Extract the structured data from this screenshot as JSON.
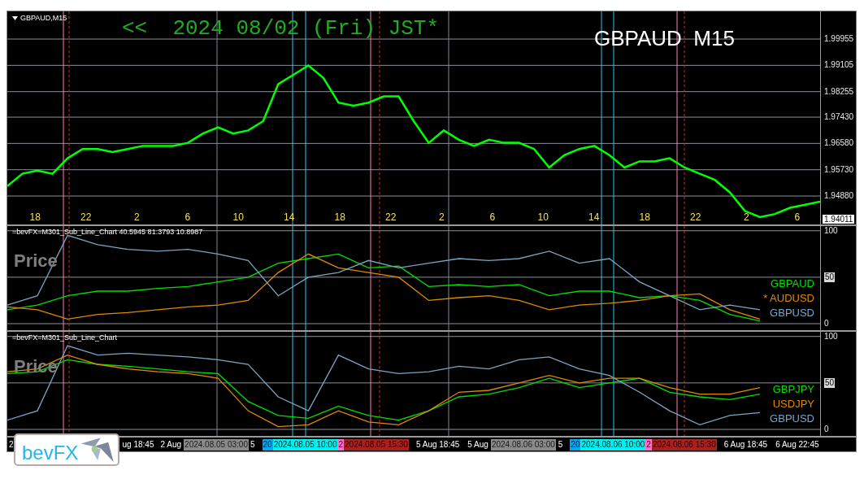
{
  "main_pane": {
    "title": "GBPAUD,M15",
    "date_banner": "<<  2024 08/02 (Fri) JST*",
    "symbol_banner": "GBPAUD  M15",
    "current_price": "1.94011",
    "hour_labels": [
      "18",
      "22",
      "2",
      "6",
      "10",
      "14",
      "18",
      "22",
      "2",
      "6",
      "10",
      "14",
      "18",
      "22",
      "2",
      "6"
    ],
    "chart_data": {
      "type": "line",
      "grid": true,
      "ylim": [
        1.9396,
        2.0085
      ],
      "yticks": [
        {
          "value": 1.99955,
          "label": "1.99955"
        },
        {
          "value": 1.99105,
          "label": "1.99105"
        },
        {
          "value": 1.98255,
          "label": "1.98255"
        },
        {
          "value": 1.9743,
          "label": "1.97430"
        },
        {
          "value": 1.9658,
          "label": "1.96580"
        },
        {
          "value": 1.9573,
          "label": "1.95730"
        },
        {
          "value": 1.9488,
          "label": "1.94880"
        }
      ],
      "values": [
        1.952,
        1.956,
        1.957,
        1.956,
        1.961,
        1.964,
        1.964,
        1.963,
        1.964,
        1.965,
        1.965,
        1.965,
        1.966,
        1.969,
        1.971,
        1.969,
        1.97,
        1.973,
        1.985,
        1.988,
        1.991,
        1.987,
        1.979,
        1.978,
        1.979,
        1.981,
        1.981,
        1.973,
        1.966,
        1.97,
        1.967,
        1.965,
        1.967,
        1.966,
        1.966,
        1.964,
        1.958,
        1.962,
        1.964,
        1.965,
        1.962,
        1.958,
        1.96,
        1.96,
        1.961,
        1.958,
        1.956,
        1.954,
        1.95,
        1.944,
        1.942,
        1.943,
        1.945,
        1.946,
        1.947
      ]
    }
  },
  "sub_panes": [
    {
      "title": "=bevFX=M301_Sub_Line_Chart 40.5945 81.3793 10.8987",
      "watermark": "Price",
      "chart_data": {
        "type": "line",
        "grid": true,
        "ylim": [
          -7,
          105
        ],
        "yticks": [
          0,
          50,
          100
        ],
        "series": [
          {
            "name": "GBPAUD",
            "color": "#00e000",
            "values": [
              15,
              20,
              30,
              35,
              35,
              38,
              40,
              45,
              50,
              65,
              70,
              75,
              60,
              62,
              40,
              42,
              40,
              42,
              30,
              35,
              35,
              28,
              30,
              25,
              10,
              3,
              null,
              null
            ]
          },
          {
            "name": "* AUDUSD",
            "color": "#e08a00",
            "values": [
              18,
              15,
              5,
              10,
              12,
              15,
              18,
              20,
              25,
              55,
              75,
              60,
              55,
              50,
              25,
              28,
              30,
              25,
              15,
              20,
              22,
              25,
              30,
              32,
              15,
              5,
              null,
              null
            ]
          },
          {
            "name": "GBPUSD",
            "color": "#7aa6c2",
            "values": [
              20,
              30,
              95,
              85,
              80,
              78,
              80,
              75,
              68,
              30,
              50,
              55,
              68,
              60,
              65,
              70,
              68,
              70,
              78,
              65,
              70,
              45,
              30,
              15,
              20,
              15,
              null,
              null
            ]
          }
        ]
      }
    },
    {
      "title": "=bevFX=M301_Sub_Line_Chart",
      "watermark": "Price",
      "chart_data": {
        "type": "line",
        "grid": true,
        "ylim": [
          -7,
          105
        ],
        "yticks": [
          0,
          50,
          100
        ],
        "series": [
          {
            "name": "GBPJPY",
            "color": "#00e000",
            "values": [
              60,
              62,
              75,
              70,
              68,
              65,
              62,
              60,
              30,
              15,
              12,
              25,
              15,
              10,
              20,
              35,
              38,
              45,
              55,
              45,
              50,
              55,
              40,
              35,
              32,
              38,
              null,
              null
            ]
          },
          {
            "name": "USDJPY",
            "color": "#e08a00",
            "values": [
              62,
              65,
              80,
              70,
              65,
              62,
              60,
              55,
              20,
              3,
              5,
              20,
              8,
              5,
              20,
              40,
              42,
              50,
              58,
              50,
              55,
              55,
              45,
              38,
              38,
              45,
              null,
              null
            ]
          },
          {
            "name": "GBPUSD",
            "color": "#7aa6c2",
            "values": [
              10,
              20,
              90,
              80,
              82,
              80,
              78,
              75,
              70,
              35,
              20,
              80,
              65,
              60,
              62,
              68,
              65,
              75,
              78,
              65,
              58,
              40,
              20,
              5,
              15,
              18,
              null,
              null
            ]
          }
        ]
      }
    }
  ],
  "time_axis": [
    {
      "text": "2",
      "kind": "plain"
    },
    {
      "text": "ug 18:45",
      "kind": "plain"
    },
    {
      "text": "2 Aug",
      "kind": "plain"
    },
    {
      "text": "2024.08.05 03:00",
      "kind": "grey"
    },
    {
      "text": "5",
      "kind": "plain"
    },
    {
      "text": "20",
      "kind": "blue"
    },
    {
      "text": "2024.08.05 10:00",
      "kind": "cyan"
    },
    {
      "text": "2",
      "kind": "pink"
    },
    {
      "text": "2024.08.05 15:30",
      "kind": "red"
    },
    {
      "text": "5 Aug 18:45",
      "kind": "plain"
    },
    {
      "text": "5 Aug",
      "kind": "plain"
    },
    {
      "text": "2024.08.06 03:00",
      "kind": "grey"
    },
    {
      "text": "5",
      "kind": "plain"
    },
    {
      "text": "20",
      "kind": "blue"
    },
    {
      "text": "2024.08.06 10:00",
      "kind": "cyan"
    },
    {
      "text": "2",
      "kind": "pink"
    },
    {
      "text": "2024.08.06 15:30",
      "kind": "red"
    },
    {
      "text": "6 Aug 18:45",
      "kind": "plain"
    },
    {
      "text": "6 Aug 22:45",
      "kind": "plain"
    }
  ],
  "logo": {
    "text": "bevFX"
  }
}
